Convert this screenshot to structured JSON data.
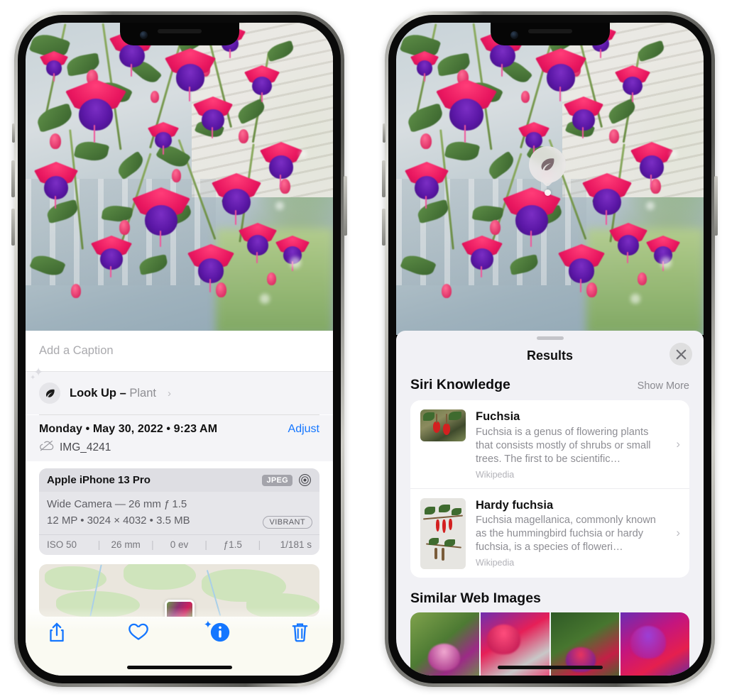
{
  "left_phone": {
    "caption_field": {
      "placeholder": "Add a Caption",
      "value": ""
    },
    "look_up": {
      "label": "Look Up – ",
      "subject": "Plant",
      "chevron": "›",
      "icon": "leaf-icon"
    },
    "metadata": {
      "date_line": "Monday • May 30, 2022 • 9:23 AM",
      "adjust_label": "Adjust",
      "file_name": "IMG_4241",
      "cloud_icon": "cloud-slash-icon"
    },
    "exif": {
      "device": "Apple iPhone 13 Pro",
      "format_badge": "JPEG",
      "aperture_icon": "aperture-icon",
      "lens_line": "Wide Camera — 26 mm ƒ 1.5",
      "size_line": "12 MP • 3024 × 4032 • 3.5 MB",
      "style_badge": "VIBRANT",
      "stats": [
        "ISO 50",
        "26 mm",
        "0 ev",
        "ƒ1.5",
        "1/181 s"
      ],
      "divider": "|"
    },
    "toolbar": [
      {
        "name": "share-icon",
        "label": "Share"
      },
      {
        "name": "favorite-heart-icon",
        "label": "Favorite"
      },
      {
        "name": "info-icon",
        "label": "Info"
      },
      {
        "name": "trash-icon",
        "label": "Delete"
      }
    ],
    "accent_color": "#1476ff"
  },
  "right_phone": {
    "badge": {
      "icon": "leaf-icon",
      "name": "visual-look-up-badge"
    },
    "sheet": {
      "title": "Results",
      "close_icon": "close-x-icon",
      "grabber": "drag-handle"
    },
    "siri_knowledge": {
      "heading": "Siri Knowledge",
      "show_more": "Show More",
      "results": [
        {
          "title": "Fuchsia",
          "description": "Fuchsia is a genus of flowering plants that consists mostly of shrubs or small trees. The first to be scientific…",
          "source": "Wikipedia",
          "thumb": "fuchsia-red-flowers-thumbnail",
          "chevron": "›"
        },
        {
          "title": "Hardy fuchsia",
          "description": "Fuchsia magellanica, commonly known as the hummingbird fuchsia or hardy fuchsia, is a species of floweri…",
          "source": "Wikipedia",
          "thumb": "hardy-fuchsia-specimen-thumbnail",
          "chevron": "›"
        }
      ]
    },
    "similar_web_images": {
      "heading": "Similar Web Images",
      "images": [
        "fuchsia-pink-white-bloom",
        "fuchsia-red-purple-closeup",
        "fuchsia-bush-buds",
        "fuchsia-purple-magenta-cluster"
      ]
    }
  }
}
